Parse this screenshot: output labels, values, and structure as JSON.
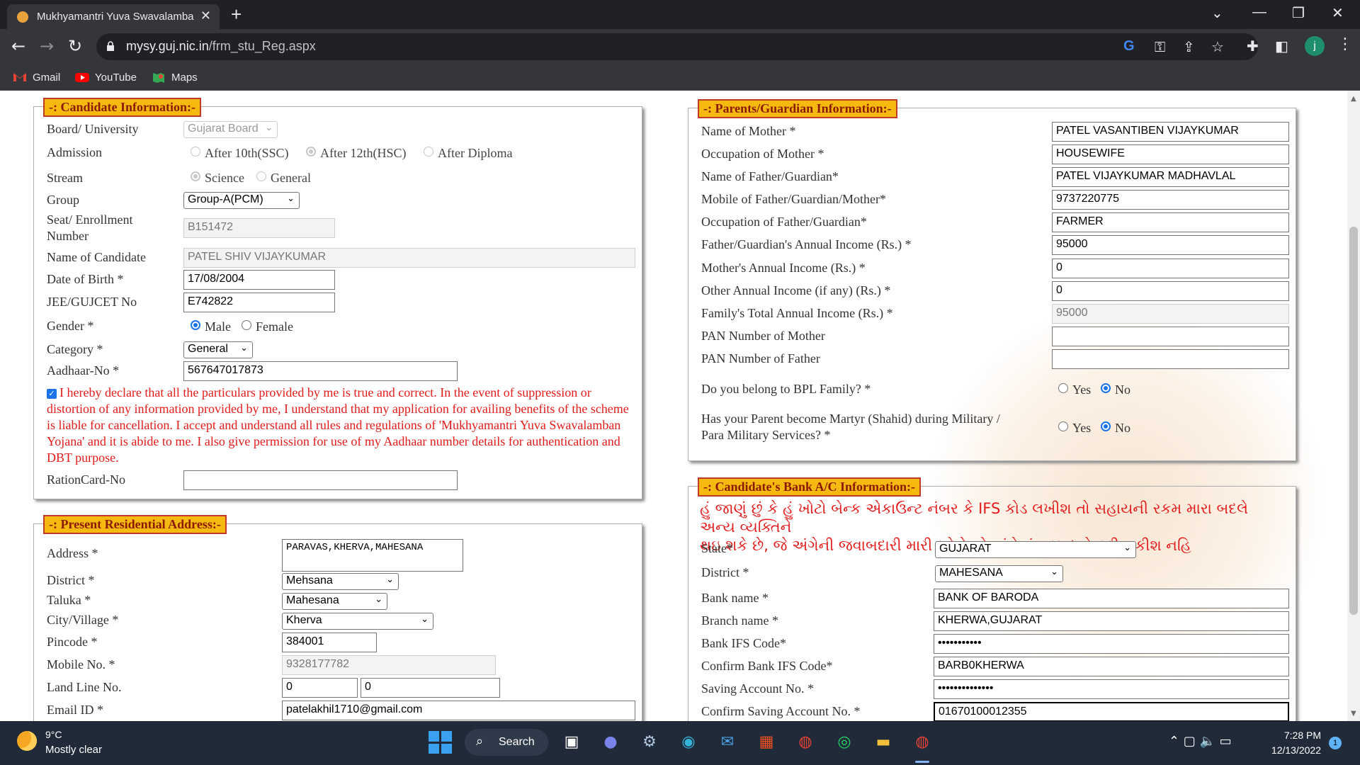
{
  "browser": {
    "tab_title": "Mukhyamantri Yuva Swavalamba",
    "tab_close": "✕",
    "new_tab": "+",
    "url_host": "mysy.guj.nic.in",
    "url_path": "/frm_stu_Reg.aspx",
    "profile_initial": "j",
    "bookmarks": [
      "Gmail",
      "YouTube",
      "Maps"
    ]
  },
  "candidate": {
    "legend": "-: Candidate Information:-",
    "board_label": "Board/ University",
    "board_value": "Gujarat Board",
    "admission_label": "Admission",
    "admission_options": [
      "After 10th(SSC)",
      "After 12th(HSC)",
      "After Diploma"
    ],
    "admission_selected": "After 12th(HSC)",
    "stream_label": "Stream",
    "stream_options": [
      "Science",
      "General"
    ],
    "stream_selected": "Science",
    "group_label": "Group",
    "group_value": "Group-A(PCM)",
    "seat_label_1": "Seat/ Enrollment",
    "seat_label_2": "Number",
    "seat_value": "B151472",
    "name_label": "Name of Candidate",
    "name_value": "PATEL SHIV VIJAYKUMAR",
    "dob_label": "Date of Birth *",
    "dob_value": "17/08/2004",
    "jee_label": "JEE/GUJCET No",
    "jee_value": "E742822",
    "gender_label": "Gender *",
    "gender_options": [
      "Male",
      "Female"
    ],
    "gender_selected": "Male",
    "category_label": "Category *",
    "category_value": "General",
    "aadhaar_label": "Aadhaar-No *",
    "aadhaar_value": "567647017873",
    "declaration": "I hereby declare that all the particulars provided by me is true and correct. In the event of suppression or distortion of any information provided by me, I understand that my application for availing benefits of the scheme is liable for cancellation. I accept and understand all rules and regulations of 'Mukhyamantri Yuva Swavalamban Yojana' and it is abide to me. I also give permission for use of my Aadhaar number details for authentication and DBT purpose.",
    "ration_label": "RationCard-No",
    "ration_value": ""
  },
  "address": {
    "legend": "-: Present Residential Address:-",
    "address_label": "Address *",
    "address_value": "PARAVAS,KHERVA,MAHESANA",
    "district_label": "District *",
    "district_value": "Mehsana",
    "taluka_label": "Taluka *",
    "taluka_value": "Mahesana",
    "city_label": "City/Village *",
    "city_value": "Kherva",
    "pincode_label": "Pincode *",
    "pincode_value": "384001",
    "mobile_label": "Mobile No. *",
    "mobile_value": "9328177782",
    "landline_label": "Land Line No.",
    "landline_std": "0",
    "landline_num": "0",
    "email_label": "Email ID *",
    "email_value": "patelakhil1710@gmail.com"
  },
  "parents": {
    "legend": "-: Parents/Guardian Information:-",
    "rows": [
      {
        "label": "Name of Mother *",
        "value": "PATEL VASANTIBEN VIJAYKUMAR"
      },
      {
        "label": "Occupation of Mother *",
        "value": "HOUSEWIFE"
      },
      {
        "label": "Name of Father/Guardian*",
        "value": "PATEL VIJAYKUMAR MADHAVLAL"
      },
      {
        "label": "Mobile of Father/Guardian/Mother*",
        "value": "9737220775"
      },
      {
        "label": "Occupation of Father/Guardian*",
        "value": "FARMER"
      },
      {
        "label": "Father/Guardian's Annual Income (Rs.) *",
        "value": "95000"
      },
      {
        "label": "Mother's Annual Income (Rs.) *",
        "value": "0"
      },
      {
        "label": "Other Annual Income (if any) (Rs.) *",
        "value": "0"
      },
      {
        "label": "Family's Total Annual Income (Rs.) *",
        "value": "95000"
      },
      {
        "label": "PAN Number of Mother",
        "value": ""
      },
      {
        "label": "PAN Number of Father",
        "value": ""
      }
    ],
    "bpl_label": "Do you belong to BPL Family? *",
    "martyr_label_1": "Has your Parent become Martyr (Shahid) during Military /",
    "martyr_label_2": "Para Military Services? *",
    "yes": "Yes",
    "no": "No"
  },
  "bank": {
    "legend": "-: Candidate's Bank A/C Information:-",
    "notice_1": "હું જાણું છું કે હું ખોટો બેન્ક એકાઉન્ટ નંબર કે IFS કોડ લખીશ તો સહાયની રકમ મારા બદલે અન્ય વ્યક્તિને",
    "notice_2": "થઇ શકે છે, જે અંગેની જવાબદારી મારી રહેશે એ અંગે હું હક્ક દાવો કરી શકીશ નહિ",
    "state_label": "State*",
    "state_value": "GUJARAT",
    "district_label": "District *",
    "district_value": "MAHESANA",
    "bankname_label": "Bank name *",
    "bankname_value": "BANK OF BARODA",
    "branch_label": "Branch name *",
    "branch_value": "KHERWA,GUJARAT",
    "ifsc_label": "Bank IFS Code*",
    "ifsc_value": "•••••••••••",
    "confirm_ifsc_label": "Confirm Bank IFS Code*",
    "confirm_ifsc_value": "BARB0KHERWA",
    "account_label": "Saving Account No. *",
    "account_value": "••••••••••••••",
    "confirm_account_label": "Confirm Saving Account No. *",
    "confirm_account_value": "01670100012355"
  },
  "taskbar": {
    "temp": "9°C",
    "weather": "Mostly clear",
    "search": "Search",
    "time": "7:28 PM",
    "date": "12/13/2022",
    "notifications": "1"
  }
}
